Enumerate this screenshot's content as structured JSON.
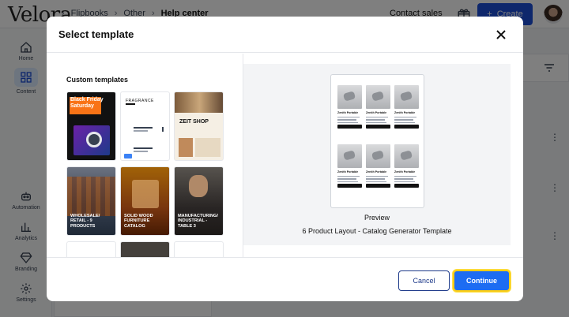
{
  "app": {
    "logo": "Velora",
    "breadcrumbs": [
      "Flipbooks",
      "Other",
      "Help center"
    ],
    "contact_label": "Contact sales",
    "create_label": "Create"
  },
  "sidebar": {
    "items": [
      {
        "label": "Home",
        "icon": "home-icon"
      },
      {
        "label": "Content",
        "icon": "grid-icon",
        "active": true
      },
      {
        "label": "Automation",
        "icon": "robot-icon"
      },
      {
        "label": "Analytics",
        "icon": "bar-chart-icon"
      },
      {
        "label": "Branding",
        "icon": "diamond-icon"
      },
      {
        "label": "Settings",
        "icon": "gear-icon"
      }
    ]
  },
  "modal": {
    "title": "Select template",
    "section_title": "Custom templates",
    "templates": [
      {
        "label": "",
        "caption": "Black Friday Saturday"
      },
      {
        "label": "",
        "caption": "FRAGRANCE"
      },
      {
        "label": "",
        "caption": "ZEIT SHOP"
      },
      {
        "label": "WHOLESALE/ RETAIL - 9 PRODUCTS"
      },
      {
        "label": "SOLID WOOD FURNITURE CATALOG"
      },
      {
        "label": "MANUFACTURING/ INDUSTRIAL - TABLE 3"
      }
    ],
    "preview": {
      "label": "Preview",
      "name": "6 Product Layout - Catalog Generator Template",
      "product_name": "Zenith Portable"
    },
    "cancel_label": "Cancel",
    "continue_label": "Continue"
  },
  "colors": {
    "primary": "#1d6cf2",
    "focus_ring": "#facc15",
    "cancel_border": "#1e3a8a"
  }
}
